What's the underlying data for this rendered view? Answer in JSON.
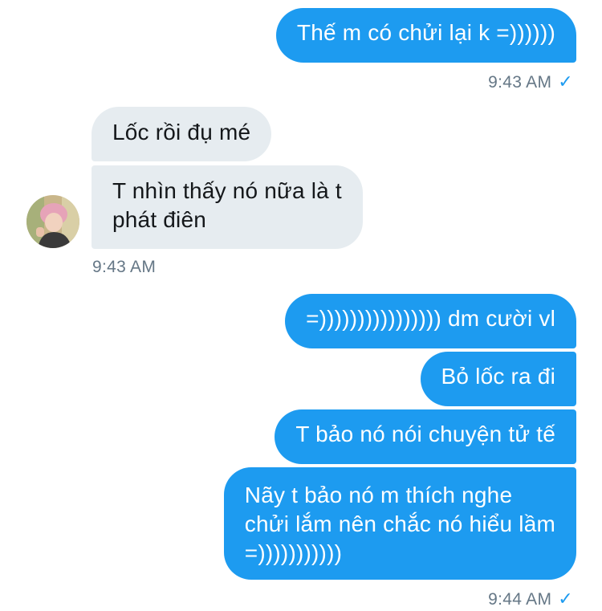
{
  "conversation": {
    "messages": [
      {
        "sender": "me",
        "text": "Thế m có chửi lại k =))))))"
      },
      {
        "sender": "me",
        "time": "9:43 AM"
      },
      {
        "sender": "other",
        "text": "Lốc rồi đụ mé"
      },
      {
        "sender": "other",
        "text": "T nhìn thấy nó nữa là t\nphát điên"
      },
      {
        "sender": "other",
        "time": "9:43 AM"
      },
      {
        "sender": "me",
        "text": "=)))))))))))))))) dm cười vl"
      },
      {
        "sender": "me",
        "text": "Bỏ lốc ra đi"
      },
      {
        "sender": "me",
        "text": "T bảo nó nói chuyện tử tế"
      },
      {
        "sender": "me",
        "text": "Nãy t bảo nó m thích nghe\nchửi lắm nên chắc nó hiểu lầm\n=)))))))))))"
      },
      {
        "sender": "me",
        "time": "9:44 AM"
      }
    ],
    "read_receipt_icon": "checkmark-icon"
  },
  "colors": {
    "outgoing_bubble": "#1d9bf0",
    "incoming_bubble": "#e6ecf0",
    "timestamp": "#657786"
  }
}
